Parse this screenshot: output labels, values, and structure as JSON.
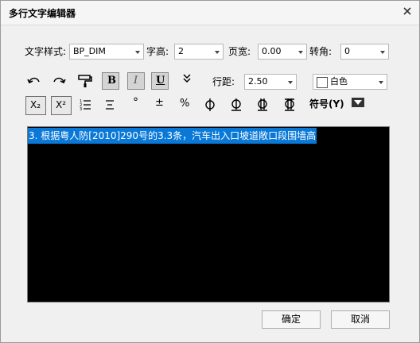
{
  "title": "多行文字编辑器",
  "labels": {
    "style": "文字样式:",
    "height": "字高:",
    "width": "页宽:",
    "angle": "转角:",
    "line_spacing": "行距:"
  },
  "fields": {
    "style_value": "BP_DIM",
    "height_value": "2",
    "width_value": "0.00",
    "angle_value": "0",
    "line_spacing_value": "2.50",
    "color_value": "白色"
  },
  "toolbar": {
    "bold": "B",
    "italic": "I",
    "underline": "U",
    "subscript": "X₂",
    "superscript": "X²",
    "degree": "°",
    "plus_minus": "±",
    "percent": "%",
    "symbol": "符号(Y)"
  },
  "editor": {
    "text": "3. 根据粤人防[2010]290号的3.3条，汽车出入口坡道敞口段围墙高"
  },
  "buttons": {
    "ok": "确定",
    "cancel": "取消"
  },
  "colors": {
    "selection": "#0a78d7",
    "editor_bg": "#000000"
  }
}
